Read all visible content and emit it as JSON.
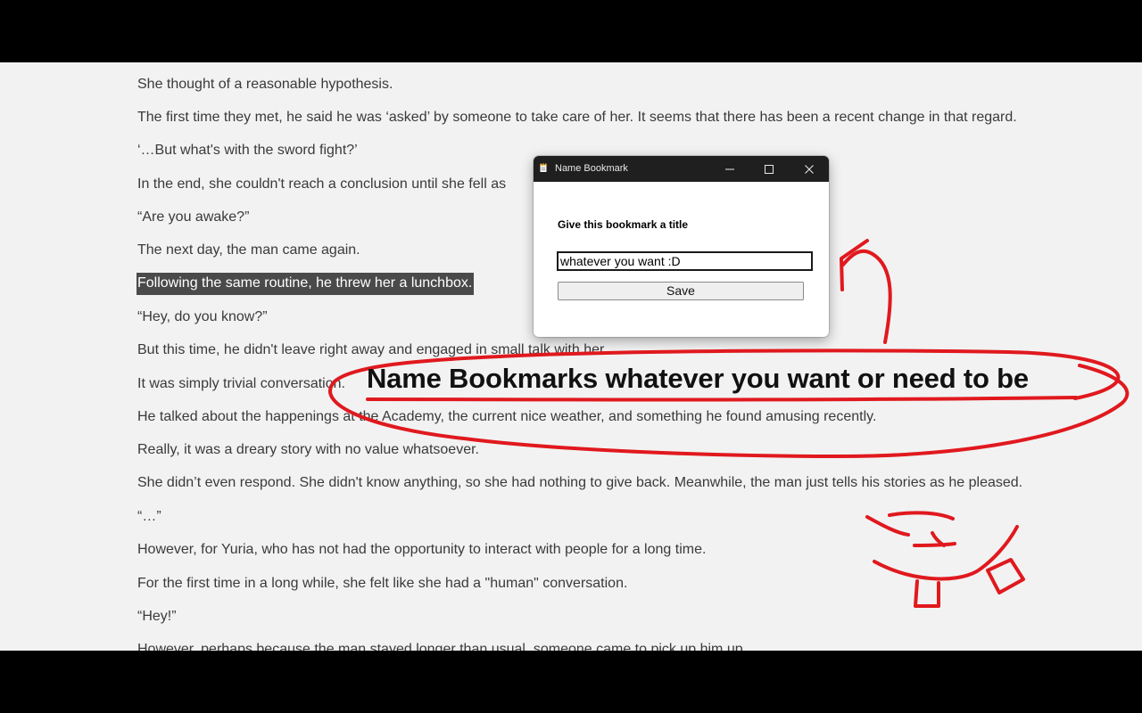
{
  "reader": {
    "paragraphs": [
      {
        "text": "She thought of a reasonable hypothesis."
      },
      {
        "text": "The first time they met, he said he was ‘asked’ by someone to take care of her. It seems that there has been a recent change in that regard."
      },
      {
        "text": "‘…But what's with the sword fight?’"
      },
      {
        "text": "In the end, she couldn't reach a conclusion until she fell as"
      },
      {
        "text": "“Are you awake?”"
      },
      {
        "text": "The next day, the man came again."
      },
      {
        "text": "Following the same routine, he threw her a lunchbox.",
        "highlighted": true
      },
      {
        "text": "“Hey, do you know?”"
      },
      {
        "text": "But this time, he didn't leave right away and engaged in small talk with her."
      },
      {
        "text": "It was simply trivial conversation."
      },
      {
        "text": "He talked about the happenings at the Academy, the current nice weather, and something he found amusing recently."
      },
      {
        "text": "Really, it was a dreary story with no value whatsoever."
      },
      {
        "text": "She didn’t even respond. She didn't know anything, so she had nothing to give back. Meanwhile, the man just tells his stories as he pleased."
      },
      {
        "text": "“…”"
      },
      {
        "text": "However, for Yuria, who has not had the opportunity to interact with people for a long time."
      },
      {
        "text": "For the first time in a long while, she felt like she had a \"human\" conversation."
      },
      {
        "text": "“Hey!”"
      },
      {
        "text": "However, perhaps because the man stayed longer than usual, someone came to pick up him up."
      }
    ]
  },
  "dialog": {
    "title": "Name Bookmark",
    "prompt": "Give this bookmark a title",
    "input_value": "whatever you want :D",
    "save_label": "Save",
    "controls": [
      "minimize-icon",
      "maximize-icon",
      "close-icon"
    ]
  },
  "annotation": {
    "callout": "Name Bookmarks whatever you want or need to be",
    "ink_color": "#e0191e"
  }
}
